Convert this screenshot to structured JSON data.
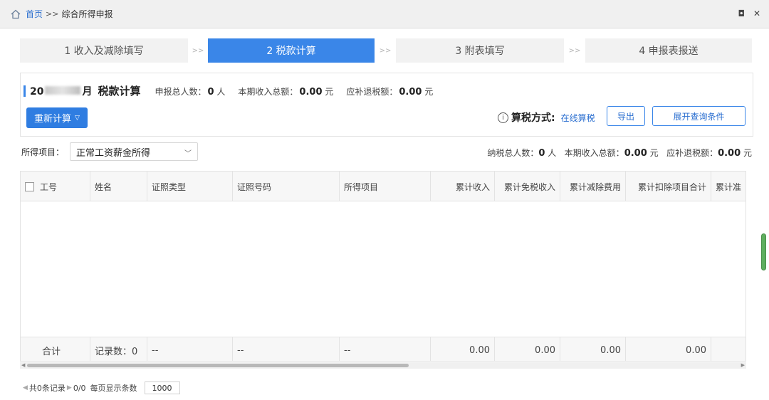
{
  "breadcrumb": {
    "home": "首页",
    "separator": ">>",
    "current": "综合所得申报"
  },
  "window": {
    "restore_glyph": "◘",
    "close_glyph": "✕"
  },
  "steps": [
    {
      "label": "1 收入及减除填写",
      "active": false
    },
    {
      "label": "2 税款计算",
      "active": true
    },
    {
      "label": "3 附表填写",
      "active": false
    },
    {
      "label": "4 申报表报送",
      "active": false
    }
  ],
  "step_separator": ">>",
  "summary": {
    "period_prefix": "20",
    "period_suffix": "月",
    "title": "税款计算",
    "declare_count_label": "申报总人数：",
    "declare_count_value": "0",
    "declare_count_unit": "人",
    "income_label": "本期收入总额：",
    "income_value": "0.00",
    "income_unit": "元",
    "tax_label": "应补退税额：",
    "tax_value": "0.00",
    "tax_unit": "元",
    "recalc_label": "重新计算",
    "method_label": "算税方式:",
    "method_value": "在线算税",
    "export_label": "导出",
    "expand_label": "展开查询条件"
  },
  "filter": {
    "label": "所得项目：",
    "selected": "正常工资薪金所得",
    "taxpayer_label": "纳税总人数：",
    "taxpayer_value": "0",
    "taxpayer_unit": "人",
    "income_label": "本期收入总额：",
    "income_value": "0.00",
    "income_unit": "元",
    "tax_label": "应补退税额：",
    "tax_value": "0.00",
    "tax_unit": "元"
  },
  "table": {
    "columns": [
      "工号",
      "姓名",
      "证照类型",
      "证照号码",
      "所得项目",
      "累计收入",
      "累计免税收入",
      "累计减除费用",
      "累计扣除项目合计",
      "累计准"
    ],
    "footer": {
      "total_label": "合计",
      "record_count": "记录数：0",
      "id_type": "--",
      "id_number": "--",
      "item": "--",
      "income": "0.00",
      "tax_free": "0.00",
      "deduction": "0.00",
      "deduction_total": "0.00"
    }
  },
  "pager": {
    "total": "共0条记录",
    "page": "0/0",
    "per_page_label": "每页显示条数",
    "per_page_value": "1000"
  },
  "colors": {
    "accent": "#3a86e8",
    "button": "#2f7de1",
    "link": "#2b6fd0"
  }
}
